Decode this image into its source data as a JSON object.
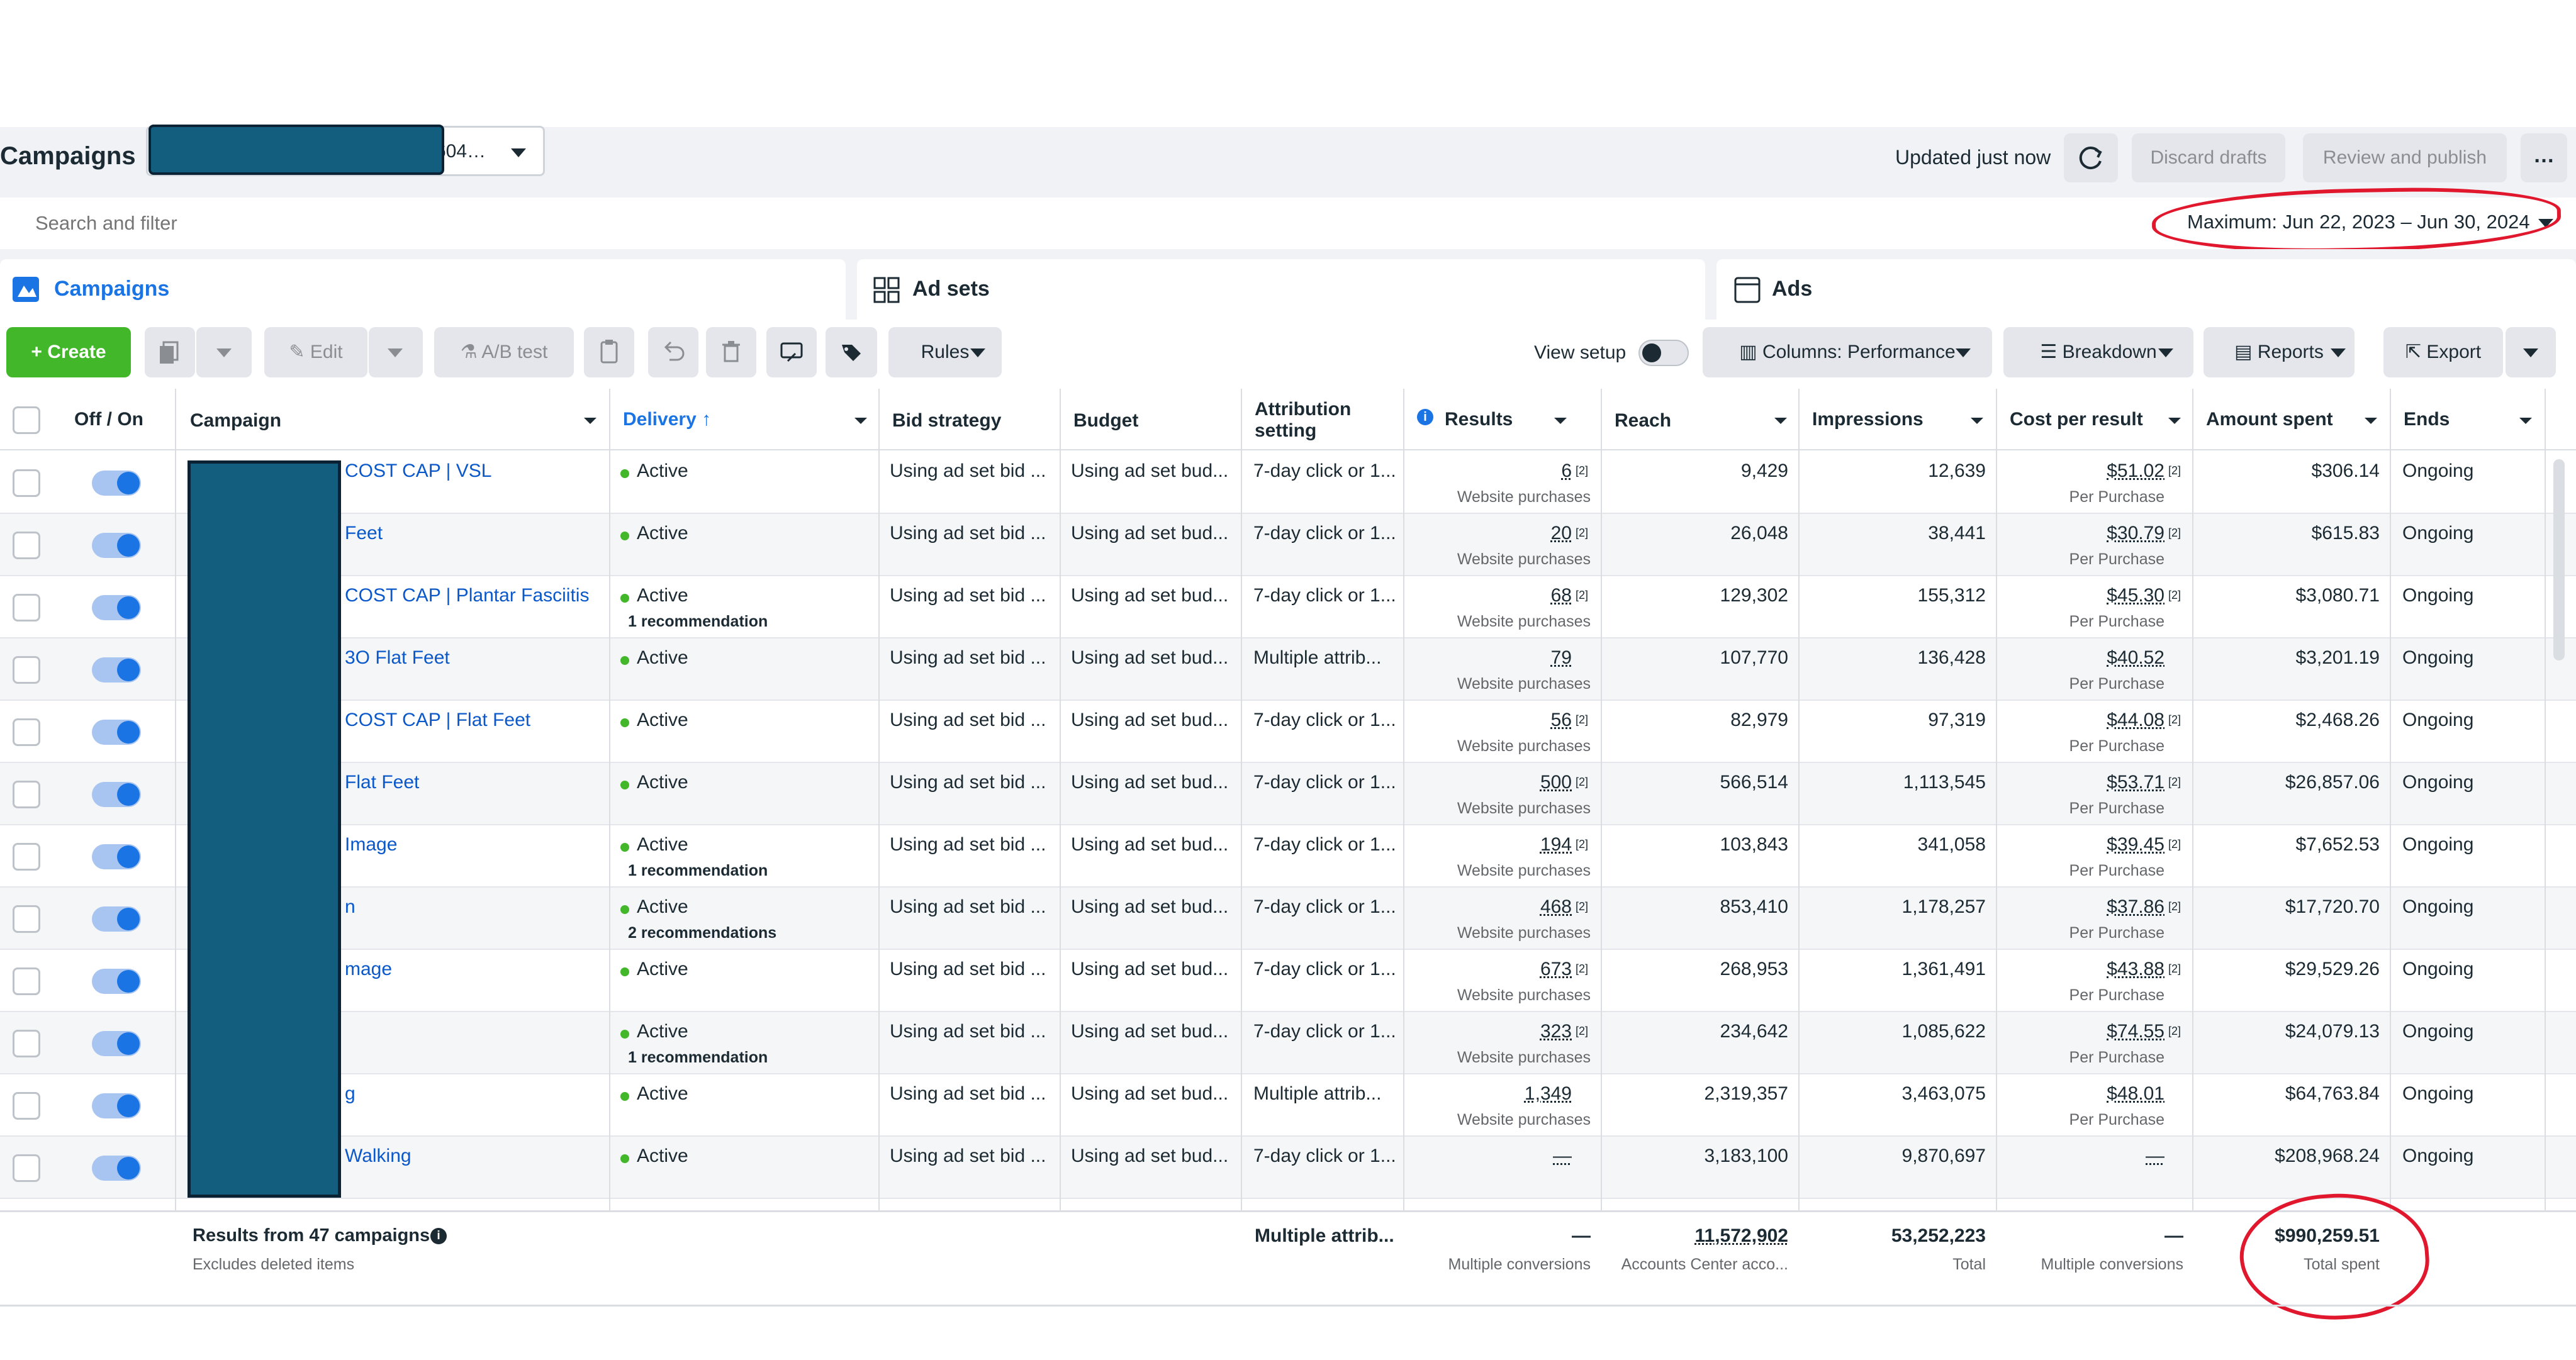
{
  "header": {
    "title": "Campaigns",
    "account_id": "604…",
    "updated": "Updated just now",
    "discard": "Discard drafts",
    "review": "Review and publish",
    "more": "…"
  },
  "search": {
    "placeholder": "Search and filter",
    "date_range": "Maximum: Jun 22, 2023 – Jun 30, 2024"
  },
  "tabs": [
    {
      "label": "Campaigns",
      "icon": "folder-icon"
    },
    {
      "label": "Ad sets",
      "icon": "grid-icon"
    },
    {
      "label": "Ads",
      "icon": "ad-frame-icon"
    }
  ],
  "toolbar": {
    "create": "Create",
    "edit": "Edit",
    "ab_test": "A/B test",
    "rules": "Rules",
    "view_setup": "View setup",
    "columns": "Columns: Performance",
    "breakdown": "Breakdown",
    "reports": "Reports",
    "export": "Export"
  },
  "columns": {
    "off_on": "Off / On",
    "campaign": "Campaign",
    "delivery": "Delivery ↑",
    "bid_strategy": "Bid strategy",
    "budget": "Budget",
    "attribution": "Attribution setting",
    "results": "Results",
    "reach": "Reach",
    "impressions": "Impressions",
    "cpr": "Cost per result",
    "spent": "Amount spent",
    "ends": "Ends"
  },
  "rows": [
    {
      "name": "COST CAP | VSL",
      "delivery": "Active",
      "rec": "",
      "bid": "Using ad set bid ...",
      "budget": "Using ad set bud...",
      "attr": "7-day click or 1...",
      "results": "6",
      "fn": "[2]",
      "results_sub": "Website purchases",
      "reach": "9,429",
      "impr": "12,639",
      "cpr": "$51.02",
      "cfn": "[2]",
      "cpr_sub": "Per Purchase",
      "spent": "$306.14",
      "ends": "Ongoing"
    },
    {
      "name": "Feet",
      "delivery": "Active",
      "rec": "",
      "bid": "Using ad set bid ...",
      "budget": "Using ad set bud...",
      "attr": "7-day click or 1...",
      "results": "20",
      "fn": "[2]",
      "results_sub": "Website purchases",
      "reach": "26,048",
      "impr": "38,441",
      "cpr": "$30.79",
      "cfn": "[2]",
      "cpr_sub": "Per Purchase",
      "spent": "$615.83",
      "ends": "Ongoing"
    },
    {
      "name": "COST CAP | Plantar Fasciitis",
      "delivery": "Active",
      "rec": "1 recommendation",
      "bid": "Using ad set bid ...",
      "budget": "Using ad set bud...",
      "attr": "7-day click or 1...",
      "results": "68",
      "fn": "[2]",
      "results_sub": "Website purchases",
      "reach": "129,302",
      "impr": "155,312",
      "cpr": "$45.30",
      "cfn": "[2]",
      "cpr_sub": "Per Purchase",
      "spent": "$3,080.71",
      "ends": "Ongoing"
    },
    {
      "name": "3O Flat Feet",
      "delivery": "Active",
      "rec": "",
      "bid": "Using ad set bid ...",
      "budget": "Using ad set bud...",
      "attr": "Multiple attrib...",
      "results": "79",
      "fn": "",
      "results_sub": "Website purchases",
      "reach": "107,770",
      "impr": "136,428",
      "cpr": "$40.52",
      "cfn": "",
      "cpr_sub": "Per Purchase",
      "spent": "$3,201.19",
      "ends": "Ongoing"
    },
    {
      "name": "COST CAP | Flat Feet",
      "delivery": "Active",
      "rec": "",
      "bid": "Using ad set bid ...",
      "budget": "Using ad set bud...",
      "attr": "7-day click or 1...",
      "results": "56",
      "fn": "[2]",
      "results_sub": "Website purchases",
      "reach": "82,979",
      "impr": "97,319",
      "cpr": "$44.08",
      "cfn": "[2]",
      "cpr_sub": "Per Purchase",
      "spent": "$2,468.26",
      "ends": "Ongoing"
    },
    {
      "name": "Flat Feet",
      "delivery": "Active",
      "rec": "",
      "bid": "Using ad set bid ...",
      "budget": "Using ad set bud...",
      "attr": "7-day click or 1...",
      "results": "500",
      "fn": "[2]",
      "results_sub": "Website purchases",
      "reach": "566,514",
      "impr": "1,113,545",
      "cpr": "$53.71",
      "cfn": "[2]",
      "cpr_sub": "Per Purchase",
      "spent": "$26,857.06",
      "ends": "Ongoing"
    },
    {
      "name": "Image",
      "delivery": "Active",
      "rec": "1 recommendation",
      "bid": "Using ad set bid ...",
      "budget": "Using ad set bud...",
      "attr": "7-day click or 1...",
      "results": "194",
      "fn": "[2]",
      "results_sub": "Website purchases",
      "reach": "103,843",
      "impr": "341,058",
      "cpr": "$39.45",
      "cfn": "[2]",
      "cpr_sub": "Per Purchase",
      "spent": "$7,652.53",
      "ends": "Ongoing"
    },
    {
      "name": "n",
      "delivery": "Active",
      "rec": "2 recommendations",
      "bid": "Using ad set bid ...",
      "budget": "Using ad set bud...",
      "attr": "7-day click or 1...",
      "results": "468",
      "fn": "[2]",
      "results_sub": "Website purchases",
      "reach": "853,410",
      "impr": "1,178,257",
      "cpr": "$37.86",
      "cfn": "[2]",
      "cpr_sub": "Per Purchase",
      "spent": "$17,720.70",
      "ends": "Ongoing"
    },
    {
      "name": "mage",
      "delivery": "Active",
      "rec": "",
      "bid": "Using ad set bid ...",
      "budget": "Using ad set bud...",
      "attr": "7-day click or 1...",
      "results": "673",
      "fn": "[2]",
      "results_sub": "Website purchases",
      "reach": "268,953",
      "impr": "1,361,491",
      "cpr": "$43.88",
      "cfn": "[2]",
      "cpr_sub": "Per Purchase",
      "spent": "$29,529.26",
      "ends": "Ongoing"
    },
    {
      "name": "",
      "delivery": "Active",
      "rec": "1 recommendation",
      "bid": "Using ad set bid ...",
      "budget": "Using ad set bud...",
      "attr": "7-day click or 1...",
      "results": "323",
      "fn": "[2]",
      "results_sub": "Website purchases",
      "reach": "234,642",
      "impr": "1,085,622",
      "cpr": "$74.55",
      "cfn": "[2]",
      "cpr_sub": "Per Purchase",
      "spent": "$24,079.13",
      "ends": "Ongoing"
    },
    {
      "name": "g",
      "delivery": "Active",
      "rec": "",
      "bid": "Using ad set bid ...",
      "budget": "Using ad set bud...",
      "attr": "Multiple attrib...",
      "results": "1,349",
      "fn": "",
      "results_sub": "Website purchases",
      "reach": "2,319,357",
      "impr": "3,463,075",
      "cpr": "$48.01",
      "cfn": "",
      "cpr_sub": "Per Purchase",
      "spent": "$64,763.84",
      "ends": "Ongoing"
    },
    {
      "name": "Walking",
      "delivery": "Active",
      "rec": "",
      "bid": "Using ad set bid ...",
      "budget": "Using ad set bud...",
      "attr": "7-day click or 1...",
      "results": "—",
      "fn": "",
      "results_sub": "",
      "reach": "3,183,100",
      "impr": "9,870,697",
      "cpr": "—",
      "cfn": "",
      "cpr_sub": "",
      "spent": "$208,968.24",
      "ends": "Ongoing"
    }
  ],
  "footer": {
    "results_from": "Results from 47 campaigns",
    "excludes": "Excludes deleted items",
    "attribution": "Multiple attrib...",
    "results": "—",
    "results_sub": "Multiple conversions",
    "reach": "11,572,902",
    "reach_sub": "Accounts Center acco...",
    "impressions": "53,252,223",
    "impressions_sub": "Total",
    "cpr": "—",
    "cpr_sub": "Multiple conversions",
    "spent": "$990,259.51",
    "spent_sub": "Total spent"
  },
  "colors": {
    "accent": "#1b74e4",
    "create": "#42b72a",
    "redaction": "#135e7e",
    "annotation": "#e0172d"
  }
}
